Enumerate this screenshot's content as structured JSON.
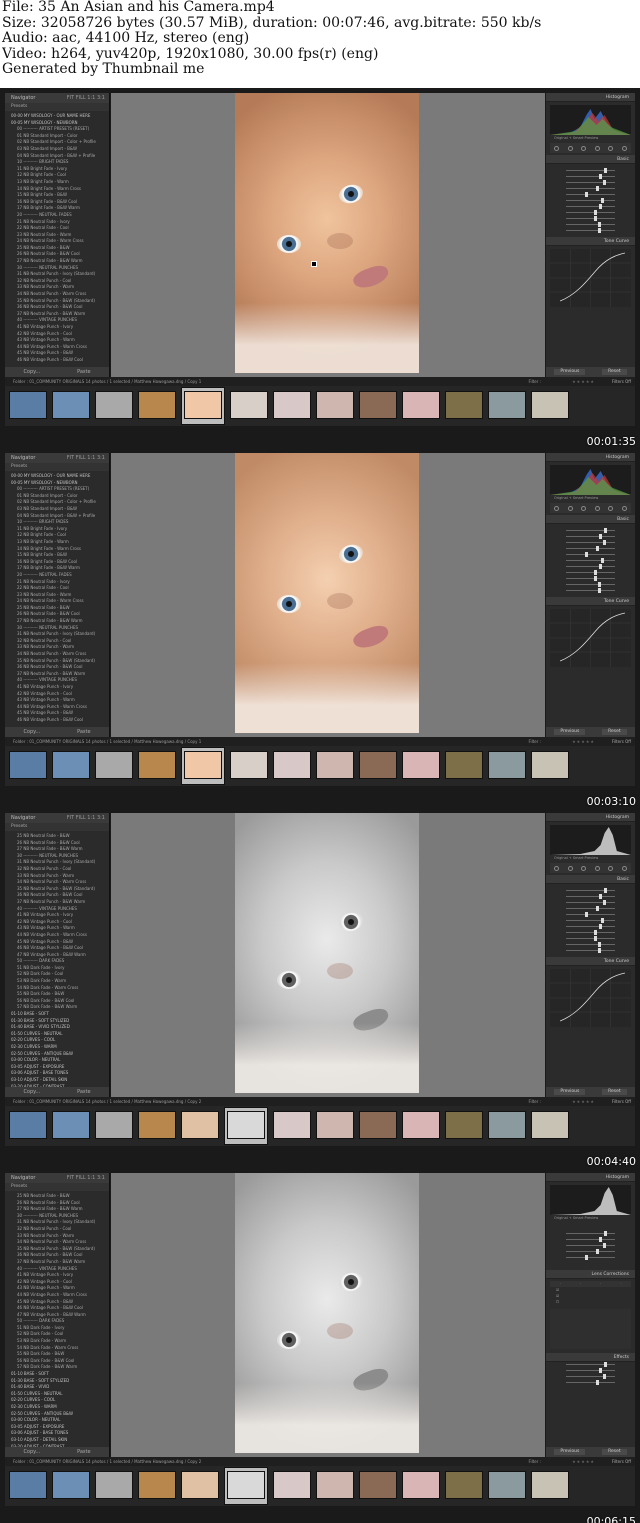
{
  "header": {
    "line1": "File: 35 An Asian and his Camera.mp4",
    "line2": "Size: 32058726 bytes (30.57 MiB), duration: 00:07:46, avg.bitrate: 550 kb/s",
    "line3": "Audio: aac, 44100 Hz, stereo (eng)",
    "line4": "Video: h264, yuv420p, 1920x1080, 30.00 fps(r) (eng)",
    "line5": "Generated by Thumbnail me"
  },
  "common": {
    "navigator": "Navigator",
    "nav_opts": "FIT  FILL  1:1  3:1",
    "presets": "Presets",
    "copy": "Copy...",
    "paste": "Paste",
    "histogram": "Histogram",
    "original_photo": "Original + Smart Preview",
    "basic": "Basic",
    "tone_curve": "Tone Curve",
    "lens_corrections": "Lens Corrections",
    "effects": "Effects",
    "previous": "Previous",
    "reset": "Reset",
    "filter": "Filter :",
    "filters_off": "Filters Off",
    "stars": "★★★★★"
  },
  "frames": [
    {
      "timestamp": "00:01:35",
      "strip": "Folder : 01_COMMUNITY ORIGINALS    14 photos / 1 selected / Matthew Hawegawa.dng / Copy 1",
      "presets": [
        {
          "t": "00-00 MY WISOLOGY - OUR NAME HERE",
          "f": true
        },
        {
          "t": "00-05 MY WISOLOGY - NEWBORN",
          "f": true
        },
        {
          "t": "00 ---------- ARTIST PRESETS (RESET)"
        },
        {
          "t": "01 NB Standard Import - Color"
        },
        {
          "t": "02 NB Standard Import - Color + Profile"
        },
        {
          "t": "03 NB Standard Import - B&W"
        },
        {
          "t": "04 NB Standard Import - B&W + Profile"
        },
        {
          "t": "10 ---------- BRIGHT FADES"
        },
        {
          "t": "11 NB Bright Fade - Ivory"
        },
        {
          "t": "12 NB Bright Fade - Cool"
        },
        {
          "t": "13 NB Bright Fade - Warm"
        },
        {
          "t": "14 NB Bright Fade - Warm Cross"
        },
        {
          "t": "15 NB Bright Fade - B&W"
        },
        {
          "t": "16 NB Bright Fade - B&W Cool"
        },
        {
          "t": "17 NB Bright Fade - B&W Warm"
        },
        {
          "t": "20 ---------- NEUTRAL FADES"
        },
        {
          "t": "21 NB Neutral Fade - Ivory"
        },
        {
          "t": "22 NB Neutral Fade - Cool"
        },
        {
          "t": "23 NB Neutral Fade - Warm"
        },
        {
          "t": "24 NB Neutral Fade - Warm Cross"
        },
        {
          "t": "25 NB Neutral Fade - B&W"
        },
        {
          "t": "26 NB Neutral Fade - B&W Cool"
        },
        {
          "t": "27 NB Neutral Fade - B&W Warm"
        },
        {
          "t": "30 ---------- NEUTRAL PUNCHES"
        },
        {
          "t": "31 NB Neutral Punch - Ivory (Standard)"
        },
        {
          "t": "32 NB Neutral Punch - Cool"
        },
        {
          "t": "33 NB Neutral Punch - Warm"
        },
        {
          "t": "34 NB Neutral Punch - Warm Cross"
        },
        {
          "t": "35 NB Neutral Punch - B&W (Standard)"
        },
        {
          "t": "36 NB Neutral Punch - B&W Cool"
        },
        {
          "t": "37 NB Neutral Punch - B&W Warm"
        },
        {
          "t": "40 ---------- VINTAGE PUNCHES"
        },
        {
          "t": "41 NB Vintage Punch - Ivory"
        },
        {
          "t": "42 NB Vintage Punch - Cool"
        },
        {
          "t": "43 NB Vintage Punch - Warm"
        },
        {
          "t": "44 NB Vintage Punch - Warm Cross"
        },
        {
          "t": "45 NB Vintage Punch - B&W"
        },
        {
          "t": "46 NB Vintage Punch - B&W Cool"
        }
      ]
    },
    {
      "timestamp": "00:03:10",
      "strip": "Folder : 01_COMMUNITY ORIGINALS    14 photos / 1 selected / Matthew Hawegawa.dng / Copy 1",
      "presets": [
        {
          "t": "00-00 MY WISOLOGY - OUR NAME HERE",
          "f": true
        },
        {
          "t": "00-05 MY WISOLOGY - NEWBORN",
          "f": true
        },
        {
          "t": "00 ---------- ARTIST PRESETS (RESET)"
        },
        {
          "t": "01 NB Standard Import - Color"
        },
        {
          "t": "02 NB Standard Import - Color + Profile"
        },
        {
          "t": "03 NB Standard Import - B&W"
        },
        {
          "t": "04 NB Standard Import - B&W + Profile"
        },
        {
          "t": "10 ---------- BRIGHT FADES"
        },
        {
          "t": "11 NB Bright Fade - Ivory"
        },
        {
          "t": "12 NB Bright Fade - Cool"
        },
        {
          "t": "13 NB Bright Fade - Warm"
        },
        {
          "t": "14 NB Bright Fade - Warm Cross"
        },
        {
          "t": "15 NB Bright Fade - B&W"
        },
        {
          "t": "16 NB Bright Fade - B&W Cool"
        },
        {
          "t": "17 NB Bright Fade - B&W Warm"
        },
        {
          "t": "20 ---------- NEUTRAL FADES"
        },
        {
          "t": "21 NB Neutral Fade - Ivory"
        },
        {
          "t": "22 NB Neutral Fade - Cool"
        },
        {
          "t": "23 NB Neutral Fade - Warm"
        },
        {
          "t": "24 NB Neutral Fade - Warm Cross"
        },
        {
          "t": "25 NB Neutral Fade - B&W"
        },
        {
          "t": "26 NB Neutral Fade - B&W Cool"
        },
        {
          "t": "27 NB Neutral Fade - B&W Warm"
        },
        {
          "t": "30 ---------- NEUTRAL PUNCHES"
        },
        {
          "t": "31 NB Neutral Punch - Ivory (Standard)"
        },
        {
          "t": "32 NB Neutral Punch - Cool"
        },
        {
          "t": "33 NB Neutral Punch - Warm"
        },
        {
          "t": "34 NB Neutral Punch - Warm Cross"
        },
        {
          "t": "35 NB Neutral Punch - B&W (Standard)"
        },
        {
          "t": "36 NB Neutral Punch - B&W Cool"
        },
        {
          "t": "37 NB Neutral Punch - B&W Warm"
        },
        {
          "t": "40 ---------- VINTAGE PUNCHES"
        },
        {
          "t": "41 NB Vintage Punch - Ivory"
        },
        {
          "t": "42 NB Vintage Punch - Cool"
        },
        {
          "t": "43 NB Vintage Punch - Warm"
        },
        {
          "t": "44 NB Vintage Punch - Warm Cross"
        },
        {
          "t": "45 NB Vintage Punch - B&W"
        },
        {
          "t": "46 NB Vintage Punch - B&W Cool"
        }
      ]
    },
    {
      "timestamp": "00:04:40",
      "strip": "Folder : 01_COMMUNITY ORIGINALS    14 photos / 1 selected / Matthew Hawegawa.dng / Copy 2",
      "presets": [
        {
          "t": "25 NB Neutral Fade - B&W"
        },
        {
          "t": "26 NB Neutral Fade - B&W Cool"
        },
        {
          "t": "27 NB Neutral Fade - B&W Warm"
        },
        {
          "t": "30 ---------- NEUTRAL PUNCHES"
        },
        {
          "t": "31 NB Neutral Punch - Ivory (Standard)"
        },
        {
          "t": "32 NB Neutral Punch - Cool"
        },
        {
          "t": "33 NB Neutral Punch - Warm"
        },
        {
          "t": "34 NB Neutral Punch - Warm Cross"
        },
        {
          "t": "35 NB Neutral Punch - B&W (Standard)"
        },
        {
          "t": "36 NB Neutral Punch - B&W Cool"
        },
        {
          "t": "37 NB Neutral Punch - B&W Warm"
        },
        {
          "t": "40 ---------- VINTAGE PUNCHES"
        },
        {
          "t": "41 NB Vintage Punch - Ivory"
        },
        {
          "t": "42 NB Vintage Punch - Cool"
        },
        {
          "t": "43 NB Vintage Punch - Warm"
        },
        {
          "t": "44 NB Vintage Punch - Warm Cross"
        },
        {
          "t": "45 NB Vintage Punch - B&W"
        },
        {
          "t": "46 NB Vintage Punch - B&W Cool"
        },
        {
          "t": "47 NB Vintage Punch - B&W Warm"
        },
        {
          "t": "50 ---------- DARK FADES"
        },
        {
          "t": "51 NB Dark Fade - Ivory"
        },
        {
          "t": "52 NB Dark Fade - Cool"
        },
        {
          "t": "53 NB Dark Fade - Warm"
        },
        {
          "t": "54 NB Dark Fade - Warm Cross"
        },
        {
          "t": "55 NB Dark Fade - B&W"
        },
        {
          "t": "56 NB Dark Fade - B&W Cool"
        },
        {
          "t": "57 NB Dark Fade - B&W Warm"
        },
        {
          "t": "01-10 BASE - SOFT",
          "f": true
        },
        {
          "t": "01-30 BASE - SOFT STYLIZED",
          "f": true
        },
        {
          "t": "01-40 BASE - VIVID STYLIZED",
          "f": true
        },
        {
          "t": "01-50 CURVES - NEUTRAL",
          "f": true
        },
        {
          "t": "02-20 CURVES - COOL",
          "f": true
        },
        {
          "t": "02-30 CURVES - WARM",
          "f": true
        },
        {
          "t": "02-50 CURVES - ANTIQUE B&W",
          "f": true
        },
        {
          "t": "03-00 COLOR - NEUTRAL",
          "f": true
        },
        {
          "t": "03-05 ADJUST - EXPOSURE",
          "f": true
        },
        {
          "t": "03-06 ADJUST - BASE TONES",
          "f": true
        },
        {
          "t": "03-10 ADJUST - DETAIL SKIN",
          "f": true
        },
        {
          "t": "03-20 ADJUST - CONTRAST",
          "f": true
        }
      ]
    },
    {
      "timestamp": "00:06:15",
      "strip": "Folder : 01_COMMUNITY ORIGINALS    14 photos / 1 selected / Matthew Hawegawa.dng / Copy 2",
      "presets": [
        {
          "t": "25 NB Neutral Fade - B&W"
        },
        {
          "t": "26 NB Neutral Fade - B&W Cool"
        },
        {
          "t": "27 NB Neutral Fade - B&W Warm"
        },
        {
          "t": "30 ---------- NEUTRAL PUNCHES"
        },
        {
          "t": "31 NB Neutral Punch - Ivory (Standard)"
        },
        {
          "t": "32 NB Neutral Punch - Cool"
        },
        {
          "t": "33 NB Neutral Punch - Warm"
        },
        {
          "t": "34 NB Neutral Punch - Warm Cross"
        },
        {
          "t": "35 NB Neutral Punch - B&W (Standard)"
        },
        {
          "t": "36 NB Neutral Punch - B&W Cool"
        },
        {
          "t": "37 NB Neutral Punch - B&W Warm"
        },
        {
          "t": "40 ---------- VINTAGE PUNCHES"
        },
        {
          "t": "41 NB Vintage Punch - Ivory"
        },
        {
          "t": "42 NB Vintage Punch - Cool"
        },
        {
          "t": "43 NB Vintage Punch - Warm"
        },
        {
          "t": "44 NB Vintage Punch - Warm Cross"
        },
        {
          "t": "45 NB Vintage Punch - B&W"
        },
        {
          "t": "46 NB Vintage Punch - B&W Cool"
        },
        {
          "t": "47 NB Vintage Punch - B&W Warm"
        },
        {
          "t": "50 ---------- DARK FADES"
        },
        {
          "t": "51 NB Dark Fade - Ivory"
        },
        {
          "t": "52 NB Dark Fade - Cool"
        },
        {
          "t": "53 NB Dark Fade - Warm"
        },
        {
          "t": "54 NB Dark Fade - Warm Cross"
        },
        {
          "t": "55 NB Dark Fade - B&W"
        },
        {
          "t": "56 NB Dark Fade - B&W Cool"
        },
        {
          "t": "57 NB Dark Fade - B&W Warm"
        },
        {
          "t": "01-10 BASE - SOFT",
          "f": true
        },
        {
          "t": "01-30 BASE - SOFT STYLIZED",
          "f": true
        },
        {
          "t": "01-40 BASE - VIVID",
          "f": true
        },
        {
          "t": "01-50 CURVES - NEUTRAL",
          "f": true
        },
        {
          "t": "02-20 CURVES - COOL",
          "f": true
        },
        {
          "t": "02-30 CURVES - WARM",
          "f": true
        },
        {
          "t": "02-50 CURVES - ANTIQUE B&W",
          "f": true
        },
        {
          "t": "03-00 COLOR - NEUTRAL",
          "f": true
        },
        {
          "t": "03-05 ADJUST - EXPOSURE",
          "f": true
        },
        {
          "t": "03-06 ADJUST - BASE TONES",
          "f": true
        },
        {
          "t": "03-10 ADJUST - DETAIL SKIN",
          "f": true
        },
        {
          "t": "03-20 ADJUST - CONTRAST",
          "f": true
        }
      ]
    }
  ]
}
